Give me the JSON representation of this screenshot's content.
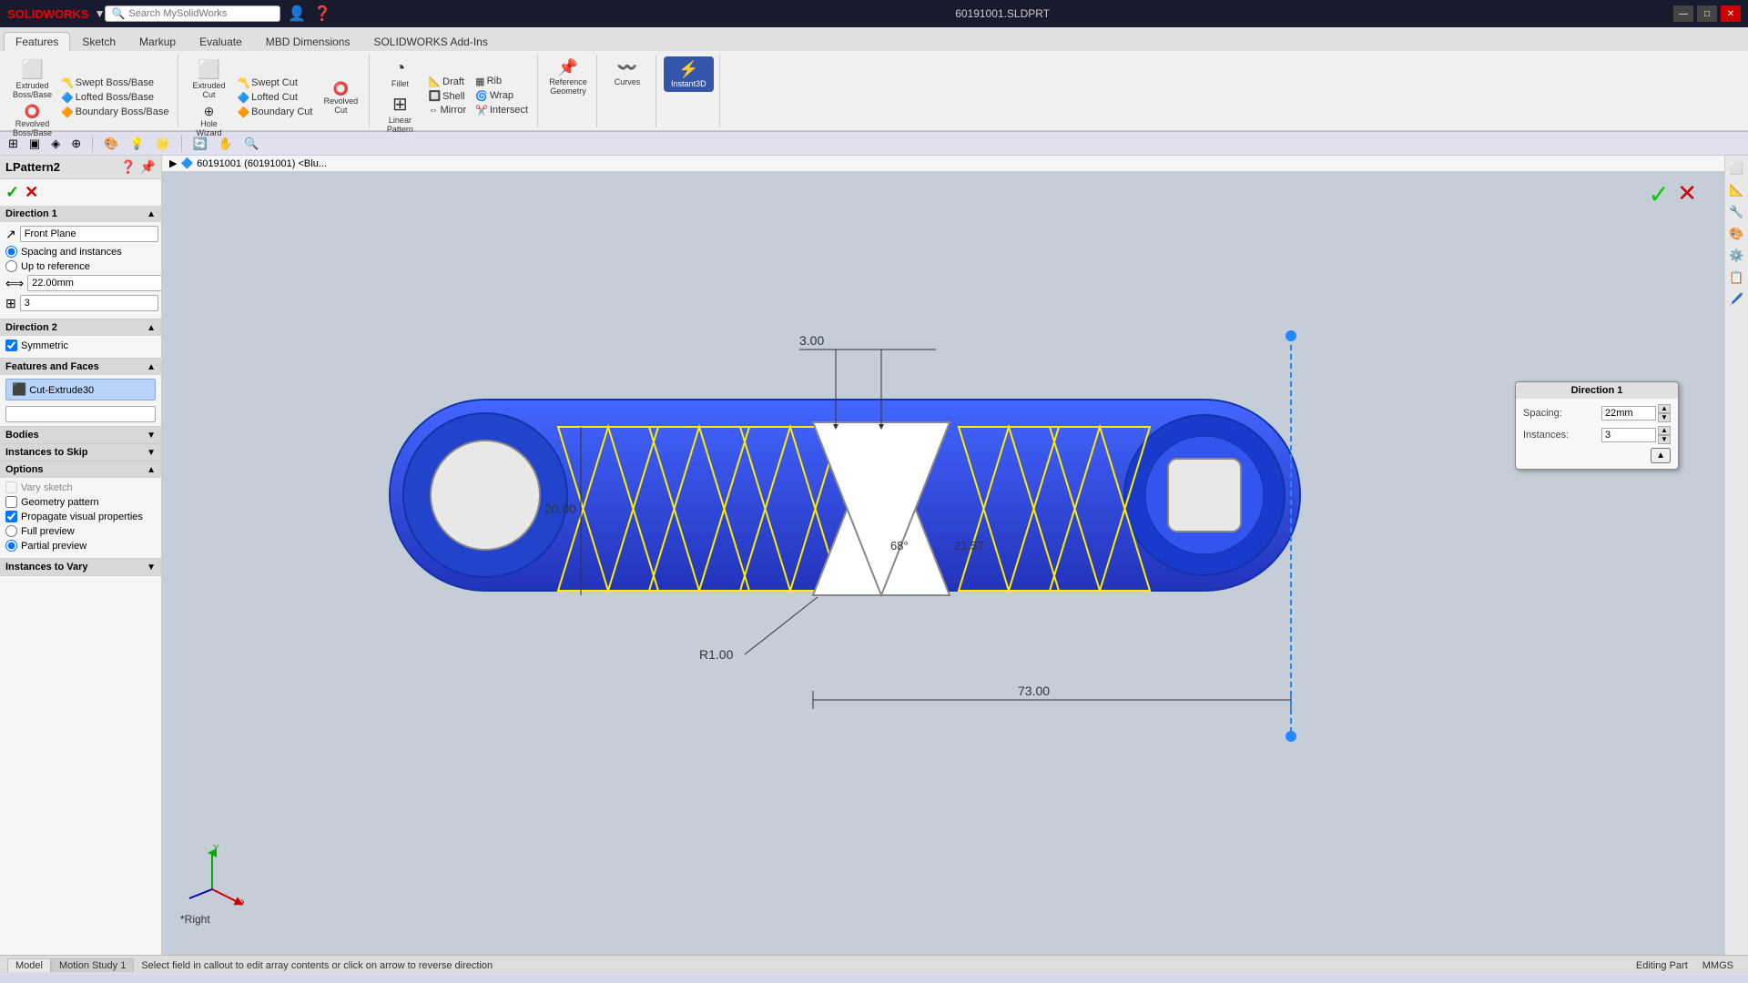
{
  "titlebar": {
    "logo": "SOLIDWORKS",
    "title": "60191001.SLDPRT",
    "search_placeholder": "Search MySolidWorks",
    "win_controls": [
      "—",
      "□",
      "✕"
    ]
  },
  "ribbon": {
    "tabs": [
      "Features",
      "Sketch",
      "Markup",
      "Evaluate",
      "MBD Dimensions",
      "SOLIDWORKS Add-Ins"
    ],
    "active_tab": "Features",
    "groups": [
      {
        "label": "",
        "buttons": [
          {
            "id": "extruded-boss",
            "label": "Extruded\nBoss/Base",
            "icon": "⬜"
          },
          {
            "id": "revolved-boss",
            "label": "Revolved\nBoss/Base",
            "icon": "⭕"
          },
          {
            "id": "swept-boss",
            "label": "Swept Boss/Base",
            "icon": "〰️"
          },
          {
            "id": "lofted-boss",
            "label": "Lofted Boss/Base",
            "icon": "🔷"
          },
          {
            "id": "boundary-boss",
            "label": "Boundary Boss/Base",
            "icon": "🔶"
          }
        ]
      }
    ],
    "cut_group": [
      "Extruded Cut",
      "Hole Wizard",
      "Revolved Cut",
      "Swept Cut",
      "Lofted Cut",
      "Boundary Cut"
    ],
    "features_group": [
      "Fillet",
      "Linear Pattern",
      "Draft",
      "Rib",
      "Shell",
      "Wrap",
      "Intersect",
      "Mirror"
    ],
    "reference_geometry": "Reference Geometry",
    "curves": "Curves",
    "instant3d": "Instant3D"
  },
  "toolbar2": {
    "items": [
      "🏠",
      "💾",
      "↩️",
      "↪️",
      "🔍"
    ]
  },
  "breadcrumb": {
    "icon": "🔷",
    "text": "60191001 (60191001) <Blu..."
  },
  "view_toolbar": {
    "buttons": [
      "⊞",
      "▣",
      "◈",
      "⊕",
      "🔲",
      "🔳",
      "⬡",
      "◐",
      "💡",
      "🖥️",
      "↗️"
    ]
  },
  "left_panel": {
    "title": "LPattern2",
    "ok_label": "✓",
    "cancel_label": "✕",
    "direction1": {
      "header": "Direction 1",
      "field_value": "Front Plane",
      "spacing_instances": "Spacing and instances",
      "up_to_reference": "Up to reference",
      "spacing_value": "22.00mm",
      "instances_value": "3"
    },
    "direction2": {
      "header": "Direction 2",
      "symmetric": "Symmetric"
    },
    "features_faces": {
      "header": "Features and Faces",
      "item": "Cut-Extrude30"
    },
    "bodies": {
      "header": "Bodies"
    },
    "instances_skip": {
      "header": "Instances to Skip"
    },
    "options": {
      "header": "Options",
      "vary_sketch": "Vary sketch",
      "geometry_pattern": "Geometry pattern",
      "propagate_visual": "Propagate visual properties",
      "full_preview": "Full preview",
      "partial_preview": "Partial preview"
    },
    "instances_vary": {
      "header": "Instances to Vary"
    }
  },
  "direction_callout": {
    "title": "Direction 1",
    "spacing_label": "Spacing:",
    "spacing_value": "22mm",
    "instances_label": "Instances:",
    "instances_value": "3"
  },
  "dimensions": {
    "d1": "3.00",
    "d2": "20.00",
    "d3": "68°",
    "d4": "21.57",
    "d5": "R1.00",
    "d6": "73.00"
  },
  "statusbar": {
    "message": "Select field in callout to edit array contents or click on arrow to reverse direction",
    "tabs": [
      "Model",
      "Motion Study 1"
    ],
    "active_tab": "Model",
    "units": "MMGS",
    "mode": "Editing Part"
  },
  "right_toolbar": {
    "icons": [
      "📐",
      "📏",
      "🔧",
      "🎨",
      "⚙️",
      "🖊️",
      "📋"
    ]
  }
}
